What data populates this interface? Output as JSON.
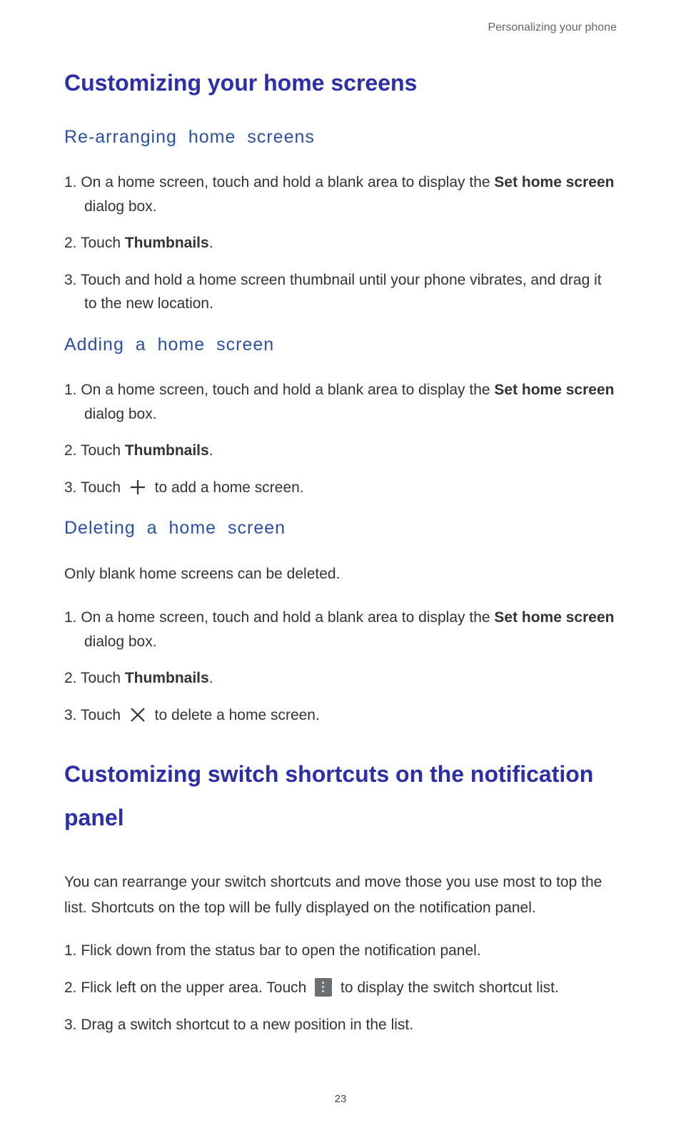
{
  "header_note": "Personalizing your phone",
  "title1": "Customizing your home screens",
  "sec1": {
    "heading": "Re-arranging  home  screens",
    "steps": {
      "s1_pre": "1. On a home screen, touch and hold a blank area to display the ",
      "s1_bold": "Set home screen",
      "s1_post": " dialog box.",
      "s2_pre": "2. Touch ",
      "s2_bold": "Thumbnails",
      "s2_post": ".",
      "s3": "3. Touch and hold a home screen thumbnail until your phone vibrates, and drag it to the new location."
    }
  },
  "sec2": {
    "heading": "Adding  a  home  screen",
    "steps": {
      "s1_pre": "1. On a home screen, touch and hold a blank area to display the ",
      "s1_bold": "Set home screen",
      "s1_post": " dialog box.",
      "s2_pre": "2. Touch ",
      "s2_bold": "Thumbnails",
      "s2_post": ".",
      "s3_pre": "3. Touch ",
      "s3_post": " to add a home screen."
    }
  },
  "sec3": {
    "heading": "Deleting  a  home  screen",
    "intro": "Only blank home screens can be deleted.",
    "steps": {
      "s1_pre": "1. On a home screen, touch and hold a blank area to display the ",
      "s1_bold": "Set home screen",
      "s1_post": " dialog box.",
      "s2_pre": "2. Touch ",
      "s2_bold": "Thumbnails",
      "s2_post": ".",
      "s3_pre": "3. Touch ",
      "s3_post": " to delete a home screen."
    }
  },
  "title2": "Customizing switch shortcuts on the notification panel",
  "para2": "You can rearrange your switch shortcuts and move those you use most to top the list. Shortcuts on the top will be fully displayed on the notification panel.",
  "steps2": {
    "s1": "1. Flick down from the status bar to open the notification panel.",
    "s2_pre": "2. Flick left on the upper area. Touch ",
    "s2_post": " to display the switch shortcut list.",
    "s3": "3. Drag a switch shortcut to a new position in the list."
  },
  "page_number": "23"
}
